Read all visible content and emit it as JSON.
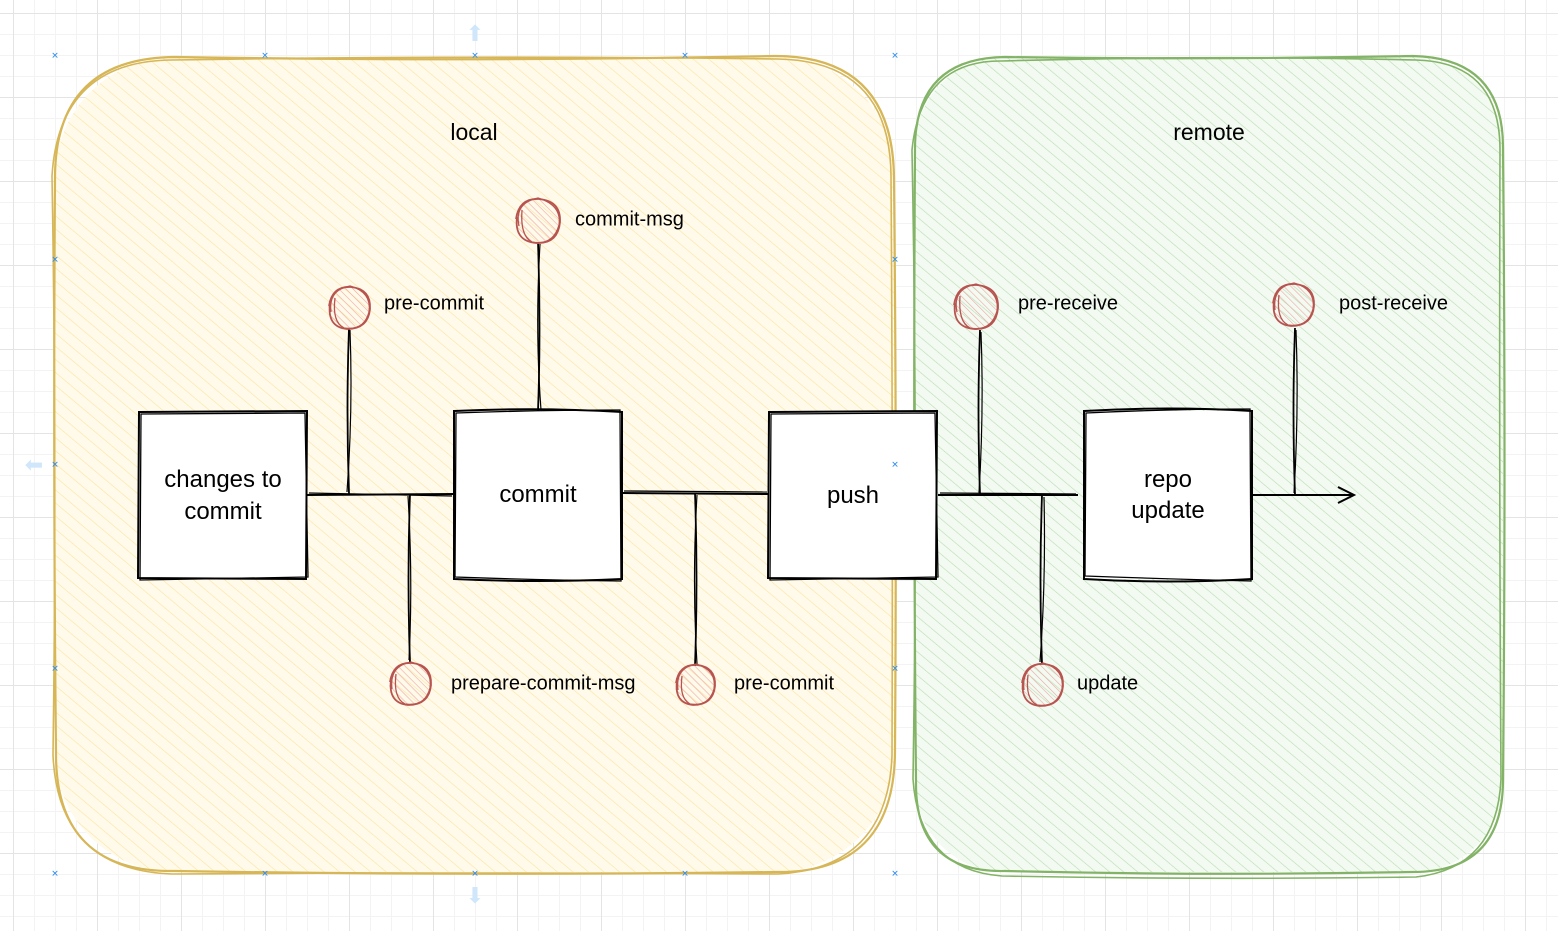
{
  "regions": {
    "local": {
      "label": "local",
      "stroke": "#d6b656",
      "fill": "#fff2cc"
    },
    "remote": {
      "label": "remote",
      "stroke": "#82b366",
      "fill": "#d5e8d4"
    }
  },
  "boxes": {
    "changes": "changes to\ncommit",
    "commit": "commit",
    "push": "push",
    "repo": "repo\nupdate"
  },
  "hooks": {
    "pre_commit_top": "pre-commit",
    "commit_msg": "commit-msg",
    "prepare_commit_msg": "prepare-commit-msg",
    "pre_commit_bottom": "pre-commit",
    "pre_receive": "pre-receive",
    "post_receive": "post-receive",
    "update": "update"
  },
  "colors": {
    "hook": "#b85450",
    "hook_fill": "#f8cecc",
    "line": "#000000",
    "selection": "#2f8ef0"
  }
}
